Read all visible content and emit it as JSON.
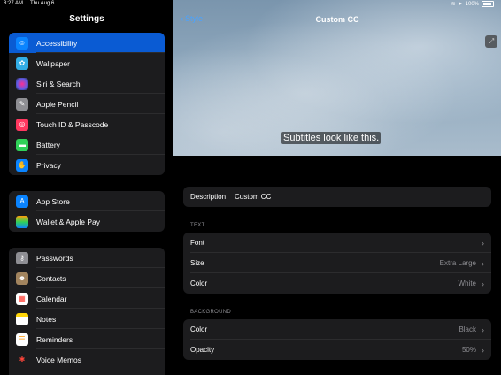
{
  "status": {
    "time": "8:27 AM",
    "date": "Thu Aug 6",
    "battery": "100%"
  },
  "sidebar": {
    "title": "Settings",
    "groups": [
      [
        {
          "label": "Accessibility",
          "icon": "accessibility-icon",
          "color": "#0a84ff",
          "active": true
        },
        {
          "label": "Wallpaper",
          "icon": "wallpaper-icon",
          "color": "#32ade6"
        },
        {
          "label": "Siri & Search",
          "icon": "siri-icon",
          "color": "#1c1c1e"
        },
        {
          "label": "Apple Pencil",
          "icon": "pencil-icon",
          "color": "#8e8e93"
        },
        {
          "label": "Touch ID & Passcode",
          "icon": "fingerprint-icon",
          "color": "#ff375f"
        },
        {
          "label": "Battery",
          "icon": "battery-icon",
          "color": "#30d158"
        },
        {
          "label": "Privacy",
          "icon": "hand-icon",
          "color": "#0a84ff"
        }
      ],
      [
        {
          "label": "App Store",
          "icon": "app-store-icon",
          "color": "#0a84ff"
        },
        {
          "label": "Wallet & Apple Pay",
          "icon": "wallet-icon",
          "color": "#2c2c2e"
        }
      ],
      [
        {
          "label": "Passwords",
          "icon": "key-icon",
          "color": "#8e8e93"
        },
        {
          "label": "Contacts",
          "icon": "contacts-icon",
          "color": "#a2845e"
        },
        {
          "label": "Calendar",
          "icon": "calendar-icon",
          "color": "#ffffff"
        },
        {
          "label": "Notes",
          "icon": "notes-icon",
          "color": "#ffd60a"
        },
        {
          "label": "Reminders",
          "icon": "reminders-icon",
          "color": "#ffffff"
        },
        {
          "label": "Voice Memos",
          "icon": "voice-memos-icon",
          "color": "#1c1c1e"
        }
      ]
    ]
  },
  "detail": {
    "back_label": "Style",
    "title": "Custom CC",
    "preview_subtitle": "Subtitles look like this.",
    "description": {
      "label": "Description",
      "value": "Custom CC"
    },
    "text_section": "TEXT",
    "text_rows": [
      {
        "label": "Font",
        "value": ""
      },
      {
        "label": "Size",
        "value": "Extra Large"
      },
      {
        "label": "Color",
        "value": "White"
      }
    ],
    "background_section": "BACKGROUND",
    "background_rows": [
      {
        "label": "Color",
        "value": "Black"
      },
      {
        "label": "Opacity",
        "value": "50%"
      }
    ]
  }
}
